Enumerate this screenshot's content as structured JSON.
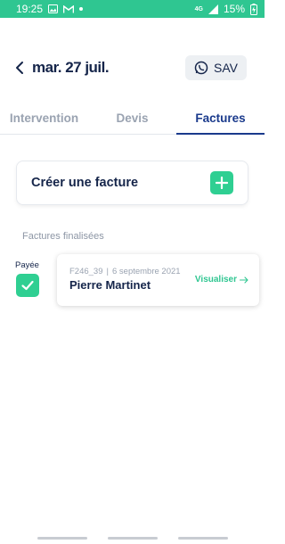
{
  "status_bar": {
    "time": "19:25",
    "network": "4G",
    "battery": "15%",
    "color": "#2fc691"
  },
  "header": {
    "title": "mar. 27 juil.",
    "sav_label": "SAV"
  },
  "tabs": [
    {
      "label": "Intervention",
      "active": false
    },
    {
      "label": "Devis",
      "active": false
    },
    {
      "label": "Factures",
      "active": true
    }
  ],
  "create_card": {
    "label": "Créer une facture"
  },
  "section_title": "Factures finalisées",
  "invoices": [
    {
      "status": "Payée",
      "number": "F246_39",
      "separator": "|",
      "date": "6 septembre 2021",
      "client": "Pierre Martinet",
      "action": "Visualiser"
    }
  ],
  "icons": {
    "back": "chevron-left-icon",
    "whatsapp": "whatsapp-icon",
    "plus": "plus-icon",
    "check": "check-icon",
    "arrow": "arrow-right-icon"
  },
  "colors": {
    "accent": "#2fcf92",
    "primary": "#1a3a8c",
    "text": "#15254a"
  }
}
